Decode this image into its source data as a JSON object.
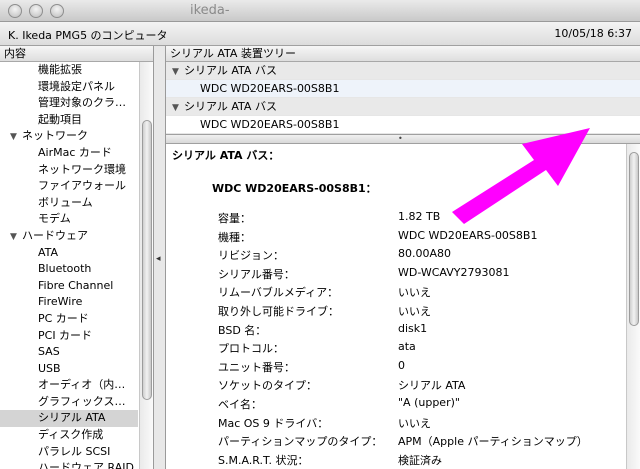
{
  "window": {
    "title": "ikeda-",
    "colors": {
      "annotation_arrow": "#ff00ff",
      "selected_row": "#d4d4d4"
    }
  },
  "header": {
    "computer_name": "K. Ikeda PMG5 のコンピュータ",
    "datetime": "10/05/18 6:37"
  },
  "sidebar": {
    "column_header": "内容",
    "items": [
      {
        "label": "機能拡張",
        "type": "item"
      },
      {
        "label": "環境設定パネル",
        "type": "item"
      },
      {
        "label": "管理対象のクラ…",
        "type": "item"
      },
      {
        "label": "起動項目",
        "type": "item"
      },
      {
        "label": "ネットワーク",
        "type": "category"
      },
      {
        "label": "AirMac カード",
        "type": "item"
      },
      {
        "label": "ネットワーク環境",
        "type": "item"
      },
      {
        "label": "ファイアウォール",
        "type": "item"
      },
      {
        "label": "ボリューム",
        "type": "item"
      },
      {
        "label": "モデム",
        "type": "item"
      },
      {
        "label": "ハードウェア",
        "type": "category"
      },
      {
        "label": "ATA",
        "type": "item"
      },
      {
        "label": "Bluetooth",
        "type": "item"
      },
      {
        "label": "Fibre Channel",
        "type": "item"
      },
      {
        "label": "FireWire",
        "type": "item"
      },
      {
        "label": "PC カード",
        "type": "item"
      },
      {
        "label": "PCI カード",
        "type": "item"
      },
      {
        "label": "SAS",
        "type": "item"
      },
      {
        "label": "USB",
        "type": "item"
      },
      {
        "label": "オーディオ（内…",
        "type": "item"
      },
      {
        "label": "グラフィックス…",
        "type": "item"
      },
      {
        "label": "シリアル ATA",
        "type": "item",
        "selected": true
      },
      {
        "label": "ディスク作成",
        "type": "item"
      },
      {
        "label": "パラレル SCSI",
        "type": "item"
      },
      {
        "label": "ハードウェア RAID",
        "type": "item"
      }
    ]
  },
  "tree": {
    "column_header": "シリアル ATA 装置ツリー",
    "rows": [
      {
        "label": "シリアル ATA バス",
        "kind": "group"
      },
      {
        "label": "WDC WD20EARS-00S8B1",
        "kind": "device"
      },
      {
        "label": "シリアル ATA バス",
        "kind": "group"
      },
      {
        "label": "WDC WD20EARS-00S8B1",
        "kind": "device"
      }
    ]
  },
  "detail": {
    "heading": "シリアル ATA バス：",
    "device_title": "WDC WD20EARS-00S8B1：",
    "properties": [
      {
        "label": "容量：",
        "value": "1.82 TB"
      },
      {
        "label": "機種：",
        "value": "WDC WD20EARS-00S8B1"
      },
      {
        "label": "リビジョン：",
        "value": "80.00A80"
      },
      {
        "label": "シリアル番号：",
        "value": "WD-WCAVY2793081"
      },
      {
        "label": "リムーバブルメディア：",
        "value": "いいえ"
      },
      {
        "label": "取り外し可能ドライブ：",
        "value": "いいえ"
      },
      {
        "label": "BSD 名：",
        "value": "disk1"
      },
      {
        "label": "プロトコル：",
        "value": "ata"
      },
      {
        "label": "ユニット番号：",
        "value": "0"
      },
      {
        "label": "ソケットのタイプ：",
        "value": "シリアル ATA"
      },
      {
        "label": "ベイ名：",
        "value": "\"A (upper)\""
      },
      {
        "label": "Mac OS 9 ドライバ：",
        "value": "いいえ"
      },
      {
        "label": "パーティションマップのタイプ：",
        "value": "APM（Apple パーティションマップ）"
      },
      {
        "label": "S.M.A.R.T. 状況：",
        "value": "検証済み"
      }
    ]
  }
}
